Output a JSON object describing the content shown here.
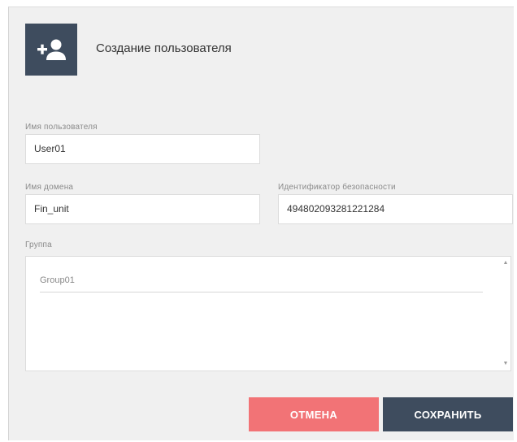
{
  "dialog": {
    "title": "Создание пользователя",
    "icon": "add-user-icon"
  },
  "fields": {
    "username": {
      "label": "Имя пользователя",
      "value": "User01"
    },
    "domain": {
      "label": "Имя домена",
      "value": "Fin_unit"
    },
    "sid": {
      "label": "Идентификатор безопасности",
      "value": "494802093281221284"
    },
    "group": {
      "label": "Группа",
      "items": [
        "Group01"
      ]
    }
  },
  "buttons": {
    "cancel_label": "ОТМЕНА",
    "save_label": "СОХРАНИТЬ"
  },
  "colors": {
    "accent_dark": "#3e4c5e",
    "cancel_red": "#f27376",
    "dialog_bg": "#f0f0f0"
  }
}
